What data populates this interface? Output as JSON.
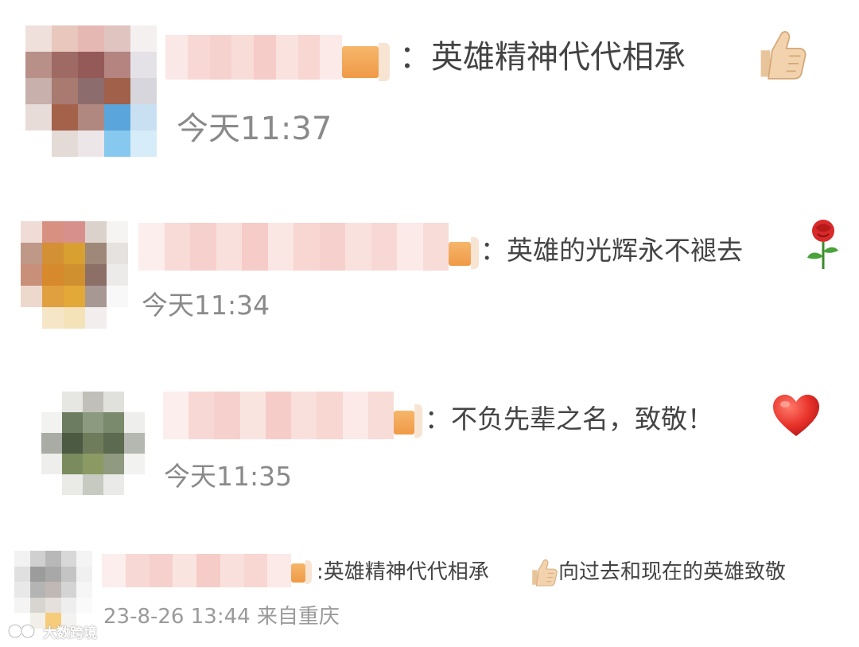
{
  "comments": [
    {
      "text": "：英雄精神代代相承",
      "time": "今天11:37",
      "emoji": "thumbs-up-icon"
    },
    {
      "text": "：英雄的光辉永不褪去",
      "time": "今天11:34",
      "emoji": "rose-icon"
    },
    {
      "text": "：不负先辈之名，致敬！",
      "time": "今天11:35",
      "emoji": "red-heart-icon"
    },
    {
      "text_before": ":英雄精神代代相承",
      "text_after": "向过去和现在的英雄致敬",
      "time": "23-8-26 13:44 来自重庆",
      "emoji": "thumbs-up-icon"
    }
  ],
  "watermark": {
    "text": "大数跨境"
  },
  "colors": {
    "text": "#444444",
    "timestamp": "#8a8a8a",
    "badge": "#ef9a47",
    "name_blur": "#f6c9c3"
  }
}
